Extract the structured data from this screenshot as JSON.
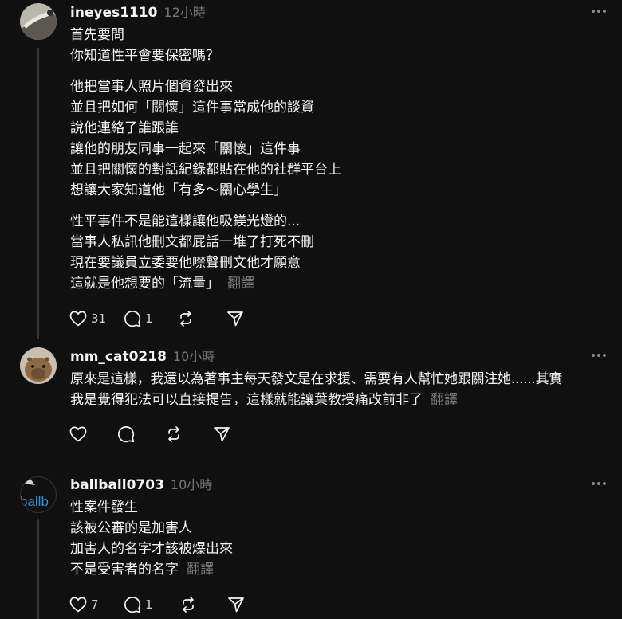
{
  "posts": [
    {
      "username": "ineyes1110",
      "time": "12小時",
      "paragraphs": [
        [
          "首先要問",
          "你知道性平會要保密嗎？"
        ],
        [
          "他把當事人照片個資發出來",
          "並且把如何「關懷」這件事當成他的談資",
          "說他連絡了誰跟誰",
          "讓他的朋友同事一起來「關懷」這件事",
          "並且把關懷的對話紀錄都貼在他的社群平台上",
          "想讓大家知道他「有多～關心學生」"
        ],
        [
          "性平事件不是能這樣讓他吸鎂光燈的...",
          "當事人私訊他刪文都屁話一堆了打死不刪",
          "現在要議員立委要他噤聲刪文他才願意",
          "這就是他想要的「流量」"
        ]
      ],
      "translate": "翻譯",
      "likes": "31",
      "replies": "1"
    },
    {
      "username": "mm_cat0218",
      "time": "10小時",
      "paragraphs": [
        [
          "原來是這樣，我還以為著事主每天發文是在求援、需要有人幫忙她跟關注她......其實",
          "我是覺得犯法可以直接提告，這樣就能讓葉教授痛改前非了"
        ]
      ],
      "translate": "翻譯",
      "likes": "",
      "replies": ""
    },
    {
      "username": "ballball0703",
      "time": "10小時",
      "avatar_text": "ballb",
      "paragraphs": [
        [
          "性案件發生",
          "該被公審的是加害人",
          "加害人的名字才該被爆出來",
          "不是受害者的名字"
        ]
      ],
      "translate": "翻譯",
      "likes": "7",
      "replies": "1"
    }
  ],
  "icons": {
    "like": "heart-icon",
    "reply": "comment-icon",
    "repost": "repost-icon",
    "share": "send-icon",
    "more": "more-icon"
  },
  "colors": {
    "background": "#101010",
    "text": "#f3f5f7",
    "secondary": "#777777",
    "thread_line": "#333638",
    "divider": "#2b2b2b"
  }
}
